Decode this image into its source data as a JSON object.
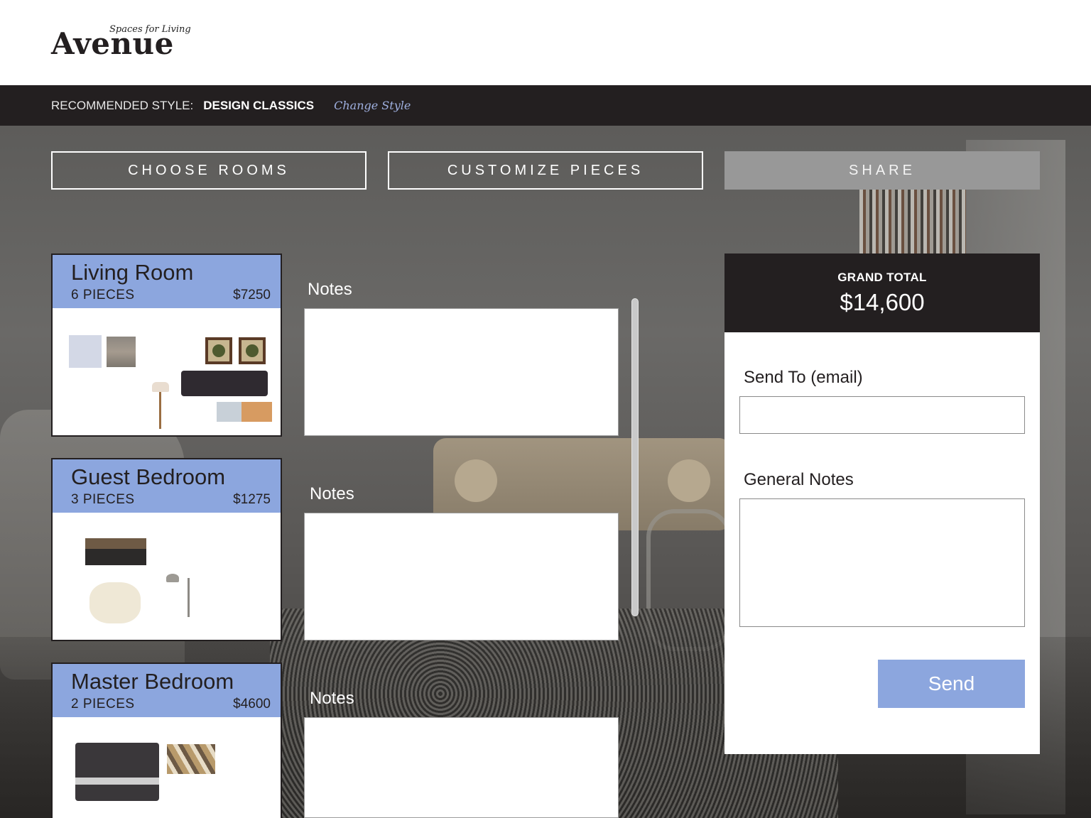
{
  "brand": {
    "name": "Avenue",
    "tagline": "Spaces for Living"
  },
  "style_bar": {
    "label": "RECOMMENDED STYLE:",
    "value": "DESIGN CLASSICS",
    "change_link": "Change Style"
  },
  "steps": [
    {
      "label": "CHOOSE ROOMS",
      "active": false
    },
    {
      "label": "CUSTOMIZE PIECES",
      "active": false
    },
    {
      "label": "SHARE",
      "active": true
    }
  ],
  "rooms": [
    {
      "title": "Living Room",
      "pieces": "6 PIECES",
      "price": "$7250",
      "notes_label": "Notes",
      "notes_value": ""
    },
    {
      "title": "Guest Bedroom",
      "pieces": "3 PIECES",
      "price": "$1275",
      "notes_label": "Notes",
      "notes_value": ""
    },
    {
      "title": "Master Bedroom",
      "pieces": "2 PIECES",
      "price": "$4600",
      "notes_label": "Notes",
      "notes_value": ""
    }
  ],
  "summary": {
    "total_label": "GRAND TOTAL",
    "total_value": "$14,600",
    "send_to_label": "Send To (email)",
    "send_to_value": "",
    "general_notes_label": "General Notes",
    "general_notes_value": "",
    "send_button": "Send"
  },
  "colors": {
    "accent_blue": "#8ca6de",
    "dark": "#231f20",
    "active_step": "#989898",
    "link": "#9fb0e0"
  },
  "icons": [
    "scrollbar"
  ]
}
